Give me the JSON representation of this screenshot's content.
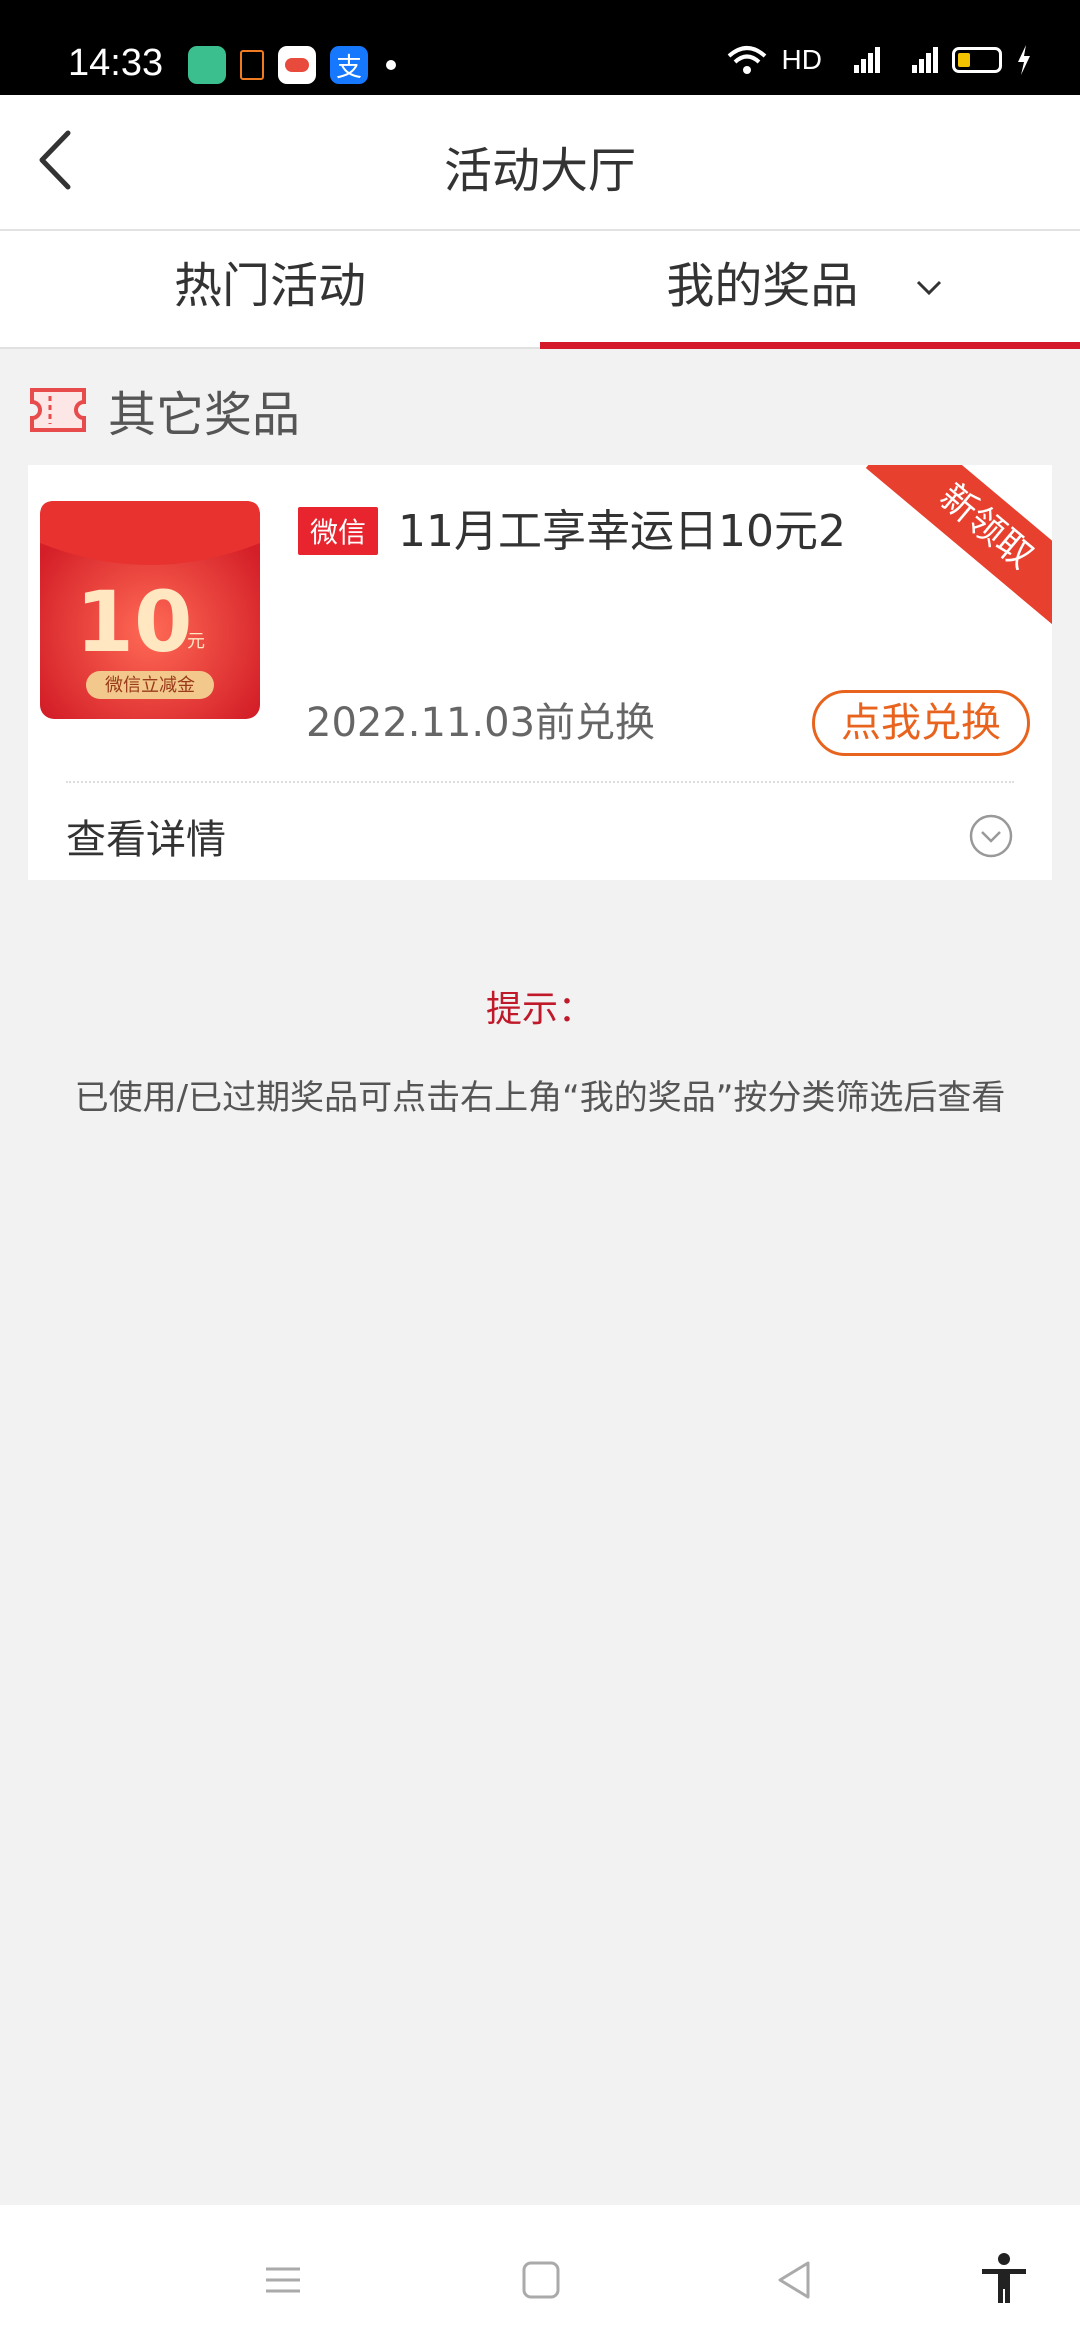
{
  "status_bar": {
    "time": "14:33",
    "network_label": "HD"
  },
  "header": {
    "title": "活动大厅"
  },
  "tabs": [
    {
      "label": "热门活动",
      "active": false
    },
    {
      "label": "我的奖品",
      "active": true
    }
  ],
  "section": {
    "label": "其它奖品"
  },
  "prize": {
    "platform": "微信",
    "name": "11月工享幸运日10元2",
    "amount": "10",
    "unit": "元",
    "voucher_label": "微信立减金",
    "expiry": "2022.11.03前兑换",
    "redeem_label": "点我兑换",
    "ribbon": "新领取",
    "details_label": "查看详情"
  },
  "tip": {
    "title": "提示：",
    "body": "已使用/已过期奖品可点击右上角“我的奖品”按分类筛选后查看"
  },
  "colors": {
    "accent": "#d3192a",
    "orange": "#e8641e",
    "bg": "#f2f2f2"
  }
}
